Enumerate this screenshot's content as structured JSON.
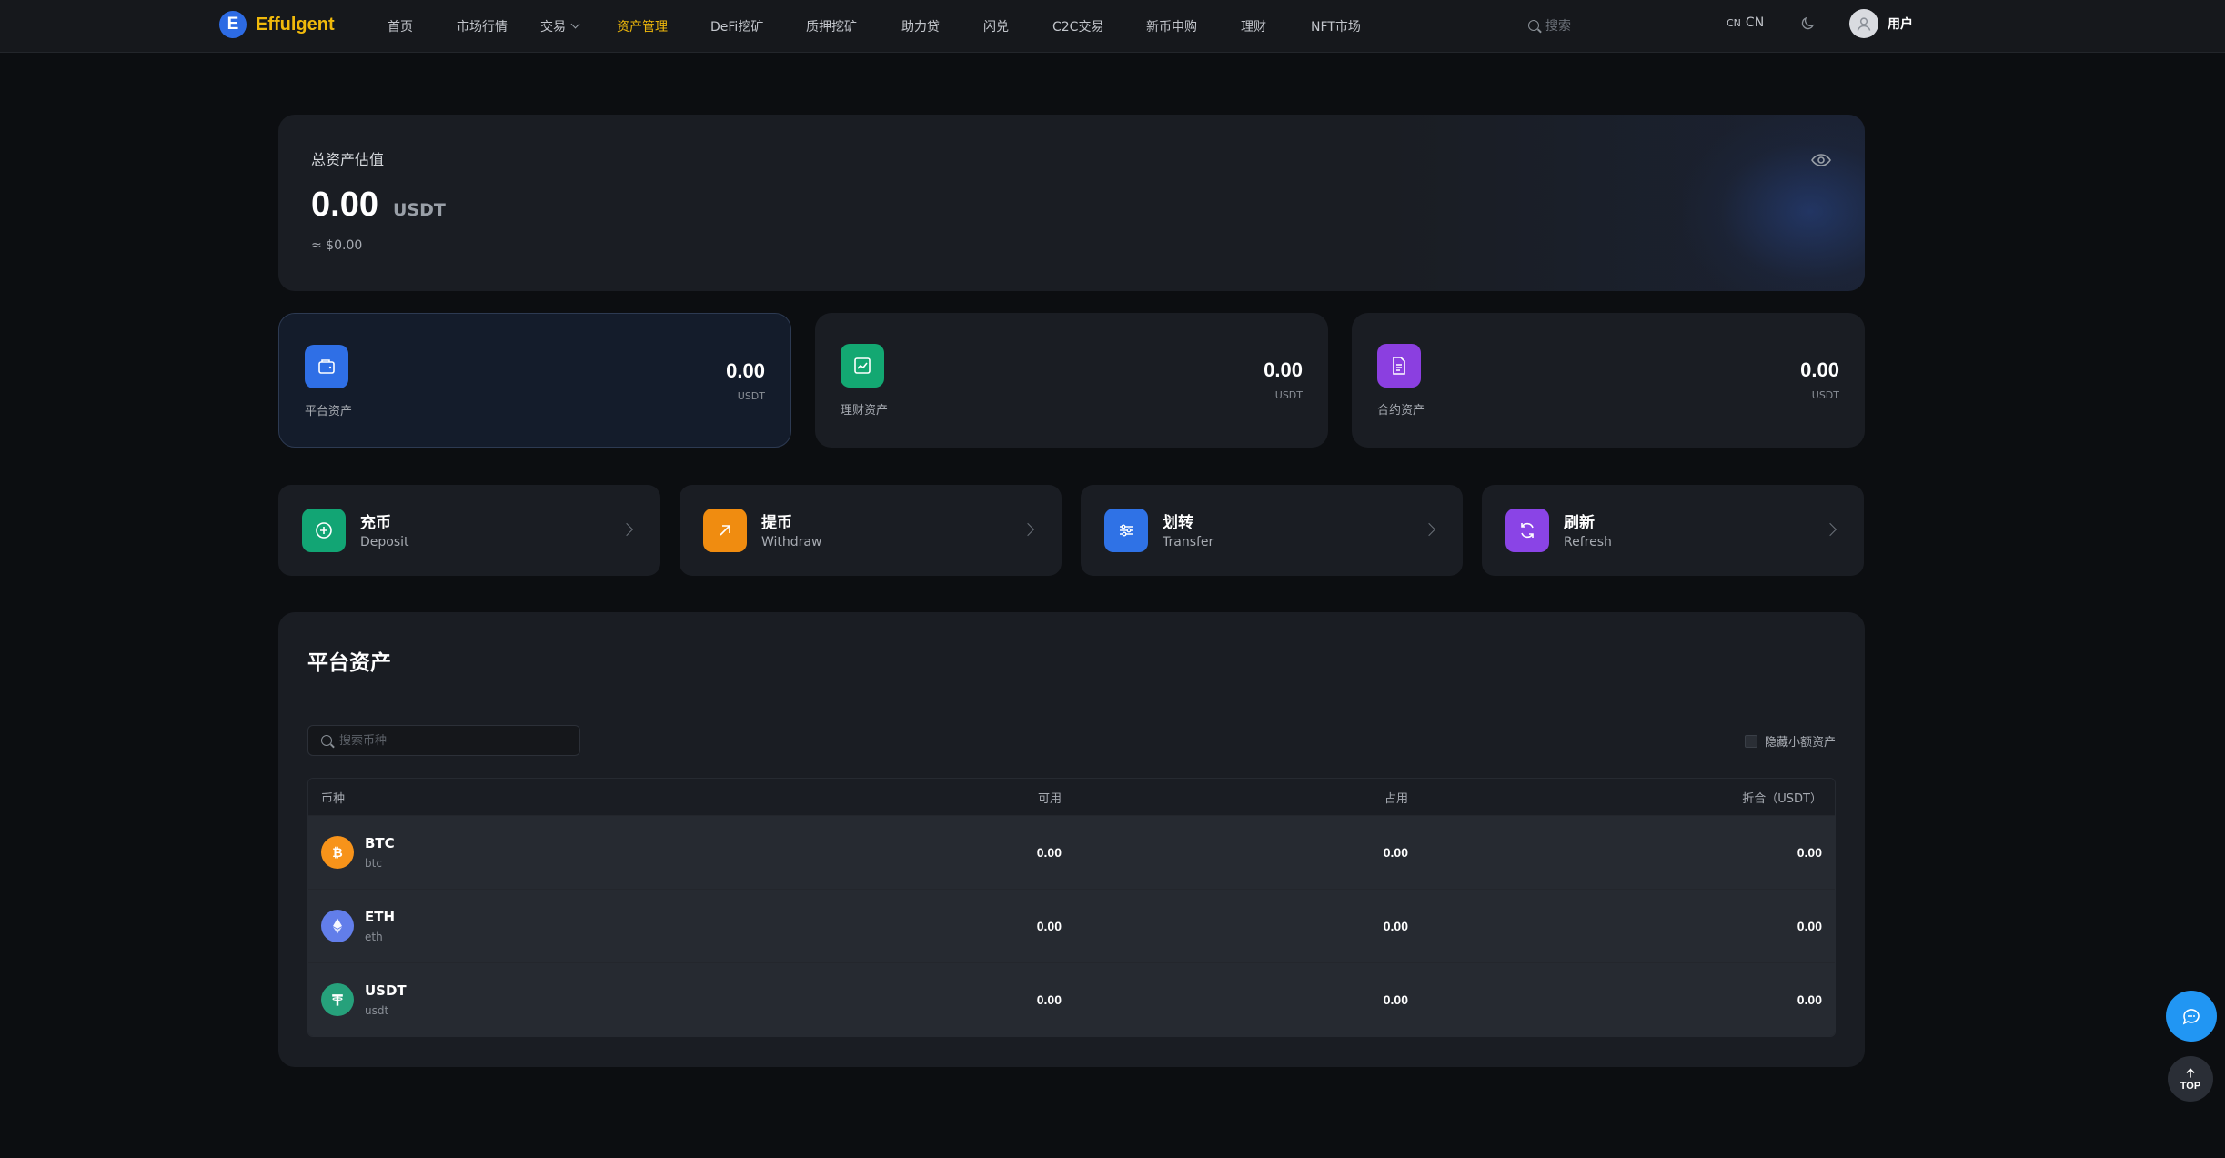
{
  "nav": {
    "logo_letter": "E",
    "logo_text": "Effulgent",
    "items": [
      {
        "label": "首页",
        "active": false
      },
      {
        "label": "市场行情",
        "active": false
      },
      {
        "label": "交易",
        "active": false,
        "dropdown": true
      },
      {
        "label": "资产管理",
        "active": true
      },
      {
        "label": "DeFi挖矿",
        "active": false
      },
      {
        "label": "质押挖矿",
        "active": false
      },
      {
        "label": "助力贷",
        "active": false
      },
      {
        "label": "闪兑",
        "active": false
      },
      {
        "label": "C2C交易",
        "active": false
      },
      {
        "label": "新币申购",
        "active": false
      },
      {
        "label": "理财",
        "active": false
      },
      {
        "label": "NFT市场",
        "active": false
      }
    ],
    "search_placeholder": "搜索",
    "lang_code_small": "CN",
    "lang_code": "CN",
    "user_label": "用户",
    "icons": {
      "search": "search-icon",
      "theme": "moon-icon",
      "avatar": "user-avatar-icon"
    }
  },
  "total": {
    "title": "总资产估值",
    "value": "0.00",
    "unit": "USDT",
    "approx": "≈ $0.00"
  },
  "assets": [
    {
      "label": "平台资产",
      "value": "0.00",
      "unit": "USDT",
      "color": "#2f6fe6",
      "icon": "wallet-icon",
      "active": true
    },
    {
      "label": "理财资产",
      "value": "0.00",
      "unit": "USDT",
      "color": "#13a872",
      "icon": "chart-icon",
      "active": false
    },
    {
      "label": "合约资产",
      "value": "0.00",
      "unit": "USDT",
      "color": "#8b3fe0",
      "icon": "document-icon",
      "active": false
    }
  ],
  "actions": [
    {
      "title": "充币",
      "subtitle": "Deposit",
      "color": "#12a574",
      "icon": "plus-circle-icon"
    },
    {
      "title": "提币",
      "subtitle": "Withdraw",
      "color": "#f08c10",
      "icon": "arrow-up-right-icon"
    },
    {
      "title": "划转",
      "subtitle": "Transfer",
      "color": "#2f72e6",
      "icon": "sliders-icon"
    },
    {
      "title": "刷新",
      "subtitle": "Refresh",
      "color": "#8a44e6",
      "icon": "refresh-icon"
    }
  ],
  "list": {
    "title": "平台资产",
    "search_placeholder": "搜索币种",
    "hide_small_label": "隐藏小额资产",
    "columns": [
      "币种",
      "可用",
      "占用",
      "折合（USDT）"
    ],
    "rows": [
      {
        "name": "BTC",
        "sub": "btc",
        "available": "0.00",
        "occupied": "0.00",
        "converted": "0.00",
        "color": "#f7931a",
        "icon": "bitcoin-icon"
      },
      {
        "name": "ETH",
        "sub": "eth",
        "available": "0.00",
        "occupied": "0.00",
        "converted": "0.00",
        "color": "#627eea",
        "icon": "ethereum-icon"
      },
      {
        "name": "USDT",
        "sub": "usdt",
        "available": "0.00",
        "occupied": "0.00",
        "converted": "0.00",
        "color": "#26a17b",
        "icon": "tether-icon"
      }
    ]
  },
  "floating": {
    "top_label": "TOP",
    "chat_icon": "chat-icon",
    "top_icon": "arrow-up-icon"
  }
}
